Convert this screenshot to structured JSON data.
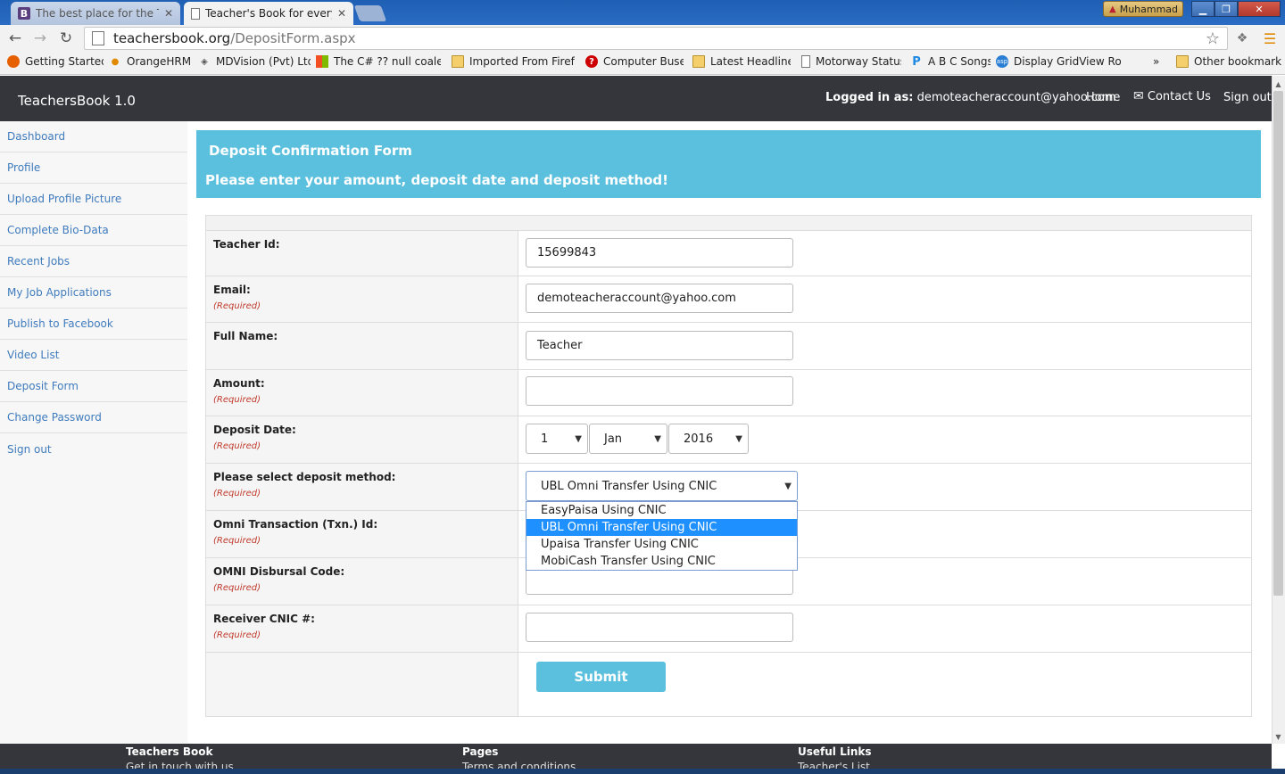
{
  "browser": {
    "tabs": [
      {
        "label": "The best place for the Tea",
        "icon": "B"
      },
      {
        "label": "Teacher's Book for every t",
        "icon": ""
      }
    ],
    "user": "Muhammad",
    "url_host": "teachersbook.org",
    "url_path": "/DepositForm.aspx",
    "bookmarks": [
      "Getting Started",
      "OrangeHRM",
      "MDVision (Pvt) Ltd.",
      "The C# ?? null coalesc",
      "Imported From Firefo",
      "Computer Buses",
      "Latest Headlines",
      "Motorway Status",
      "A B C Songs",
      "Display GridView Row",
      "»",
      "Other bookmarks"
    ]
  },
  "navbar": {
    "brand": "TeachersBook 1.0",
    "logged_in_label": "Logged in as:",
    "logged_in_email": "demoteacheraccount@yahoo.com",
    "home": "Home",
    "contact": "Contact Us",
    "signout": "Sign out"
  },
  "sidebar": {
    "items": [
      "Dashboard",
      "Profile",
      "Upload Profile Picture",
      "Complete Bio-Data",
      "Recent Jobs",
      "My Job Applications",
      "Publish to Facebook",
      "Video List",
      "Deposit Form",
      "Change Password",
      "Sign out"
    ]
  },
  "banner": {
    "title": "Deposit Confirmation Form",
    "subtitle": "Please enter your amount, deposit date and deposit method!"
  },
  "form": {
    "required_text": "(Required)",
    "teacher_id": {
      "label": "Teacher Id:",
      "value": "15699843"
    },
    "email": {
      "label": "Email:",
      "value": "demoteacheraccount@yahoo.com"
    },
    "full_name": {
      "label": "Full Name:",
      "value": "Teacher"
    },
    "amount": {
      "label": "Amount:",
      "value": ""
    },
    "deposit_date": {
      "label": "Deposit Date:",
      "day": "1",
      "month": "Jan",
      "year": "2016"
    },
    "deposit_method": {
      "label": "Please select deposit method:",
      "selected": "UBL Omni Transfer Using CNIC",
      "options": [
        "EasyPaisa Using CNIC",
        "UBL Omni Transfer Using CNIC",
        "Upaisa Transfer Using CNIC",
        "MobiCash Transfer Using CNIC"
      ]
    },
    "omni_txn": {
      "label": "Omni Transaction (Txn.) Id:"
    },
    "omni_code": {
      "label": "OMNI Disbursal Code:"
    },
    "receiver_cnic": {
      "label": "Receiver CNIC #:"
    },
    "submit": "Submit"
  },
  "footer": {
    "col1": "Teachers Book",
    "col1_sub": "Get in touch with us",
    "col2": "Pages",
    "col2_sub": "Terms and conditions",
    "col3": "Useful Links",
    "col3_sub": "Teacher's List"
  }
}
